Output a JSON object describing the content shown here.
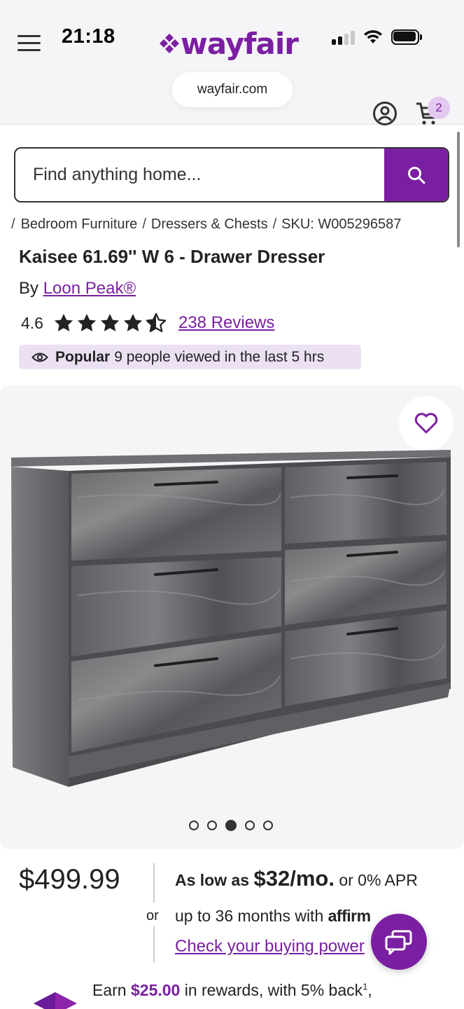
{
  "status_bar": {
    "time": "21:18"
  },
  "browser": {
    "url": "wayfair.com"
  },
  "header": {
    "logo_text": "wayfair",
    "cart_count": "2"
  },
  "search": {
    "placeholder": "Find anything home..."
  },
  "breadcrumb": {
    "lead": "/",
    "items": [
      "Bedroom Furniture",
      "Dressers & Chests",
      "SKU: W005296587"
    ],
    "separator": "/"
  },
  "product": {
    "title": "Kaisee 61.69'' W 6 - Drawer Dresser",
    "by_label": "By",
    "brand": "Loon Peak®",
    "rating": "4.6",
    "rating_value": 4.6,
    "rating_max": 5,
    "reviews_link": "238 Reviews",
    "popular_label": "Popular",
    "popular_text": "9 people viewed in the last 5 hrs"
  },
  "gallery": {
    "image_count": 5,
    "active_index": 2
  },
  "pricing": {
    "price": "$499.99",
    "or": "or",
    "as_low_as_label": "As low as",
    "monthly": "$32/mo.",
    "apr_text": "or 0% APR",
    "upto_text": "up to 36 months with",
    "affirm_text": "affirm",
    "check_link": "Check your buying power"
  },
  "rewards": {
    "earn_label": "Earn",
    "amount": "$25.00",
    "rest": "in rewards, with 5% back",
    "footnote": "1",
    "trail": ","
  },
  "colors": {
    "brand_purple": "#7b1fa2",
    "popular_bg": "#ece1f2"
  }
}
